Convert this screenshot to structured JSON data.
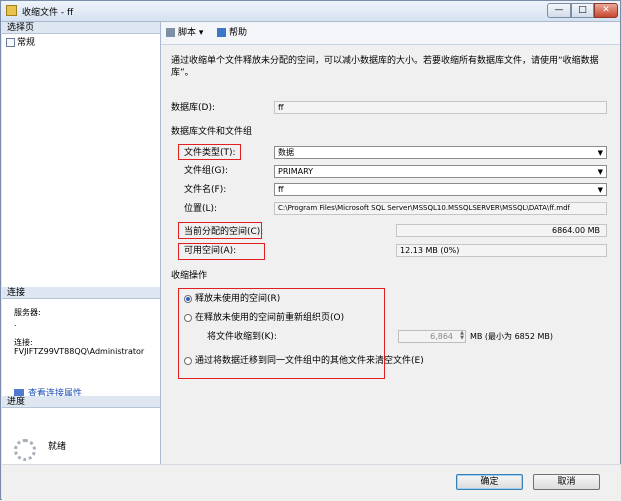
{
  "window": {
    "title": "收缩文件 - ff",
    "min_label": "—",
    "max_label": "□",
    "close_label": "✕"
  },
  "left": {
    "select_page_header": "选择页",
    "nav_items": [
      "常规"
    ],
    "connection_header": "连接",
    "server_label": "服务器:",
    "server_value": ".",
    "connection_label": "连接:",
    "connection_value": "FVJIFTZ99VT88QQ\\Administrator",
    "view_connection_link": "查看连接属性",
    "progress_header": "进度",
    "progress_status": "就绪"
  },
  "toolbar": {
    "script_label": "脚本",
    "script_arrow": "▾",
    "help_label": "帮助"
  },
  "main": {
    "description": "通过收缩单个文件释放未分配的空间，可以减小数据库的大小。若要收缩所有数据库文件，请使用“收缩数据库”。",
    "database_label": "数据库(D):",
    "database_value": "ff",
    "files_group_title": "数据库文件和文件组",
    "file_type_label": "文件类型(T):",
    "file_type_value": "数据",
    "filegroup_label": "文件组(G):",
    "filegroup_value": "PRIMARY",
    "file_name_label": "文件名(F):",
    "file_name_value": "ff",
    "location_label": "位置(L):",
    "location_value": "C:\\Program Files\\Microsoft SQL Server\\MSSQL10.MSSQLSERVER\\MSSQL\\DATA\\ff.mdf",
    "allocated_label": "当前分配的空间(C):",
    "allocated_value": "6864.00 MB",
    "available_label": "可用空间(A):",
    "available_value": "12.13 MB (0%)",
    "shrink_title": "收缩操作",
    "option_release": "释放未使用的空间(R)",
    "option_reorganize": "在释放未使用的空间前重新组织页(O)",
    "shrink_to_label": "将文件收缩到(K):",
    "shrink_to_value": "6,864",
    "shrink_to_unit": "MB (最小为 6852 MB)",
    "option_empty": "通过将数据迁移到同一文件组中的其他文件来清空文件(E)",
    "selected_option": "release"
  },
  "buttons": {
    "ok": "确定",
    "cancel": "取消"
  },
  "colors": {
    "highlight_box": "#e02020",
    "link": "#1d4fb3"
  }
}
